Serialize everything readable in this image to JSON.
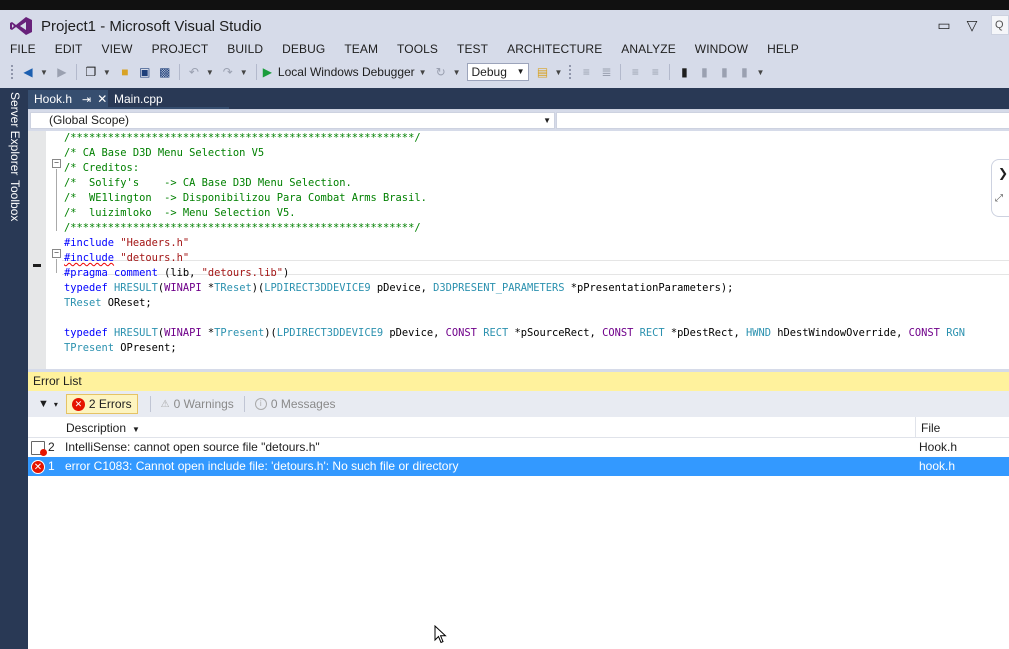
{
  "window": {
    "title": "Project1 - Microsoft Visual Studio"
  },
  "menu": [
    "FILE",
    "EDIT",
    "VIEW",
    "PROJECT",
    "BUILD",
    "DEBUG",
    "TEAM",
    "TOOLS",
    "TEST",
    "ARCHITECTURE",
    "ANALYZE",
    "WINDOW",
    "HELP"
  ],
  "toolbar": {
    "debugger_label": "Local Windows Debugger",
    "configuration": "Debug"
  },
  "quick_launch": {
    "placeholder": "Q"
  },
  "side_tabs": [
    "Server Explorer",
    "Toolbox"
  ],
  "doc_tabs": [
    {
      "label": "Hook.h",
      "active": true
    },
    {
      "label": "Main.cpp",
      "active": false
    }
  ],
  "navbar": {
    "scope": "(Global Scope)"
  },
  "code_lines": [
    [
      {
        "t": "/*******************************************************/",
        "c": "comment"
      }
    ],
    [
      {
        "t": "/* CA Base D3D Menu Selection V5",
        "c": "comment"
      }
    ],
    [
      {
        "t": "/* Creditos:",
        "c": "comment"
      }
    ],
    [
      {
        "t": "/*  Solify's    -> CA Base D3D Menu Selection.",
        "c": "comment"
      }
    ],
    [
      {
        "t": "/*  WE1lington  -> Disponibilizou Para Combat Arms Brasil.",
        "c": "comment"
      }
    ],
    [
      {
        "t": "/*  luizimloko  -> Menu Selection V5.",
        "c": "comment"
      }
    ],
    [
      {
        "t": "/*******************************************************/",
        "c": "comment"
      }
    ],
    [
      {
        "t": "#include ",
        "c": "kw"
      },
      {
        "t": "\"Headers.h\"",
        "c": "str"
      }
    ],
    [
      {
        "t": "#include",
        "c": "kw",
        "squiggle": true
      },
      {
        "t": " ",
        "c": "plain"
      },
      {
        "t": "\"detours.h\"",
        "c": "str"
      }
    ],
    [
      {
        "t": "#pragma ",
        "c": "kw"
      },
      {
        "t": "comment ",
        "c": "kw"
      },
      {
        "t": "(lib, ",
        "c": "plain"
      },
      {
        "t": "\"detours.lib\"",
        "c": "str"
      },
      {
        "t": ")",
        "c": "plain"
      }
    ],
    [
      {
        "t": "typedef ",
        "c": "kw"
      },
      {
        "t": "HRESULT",
        "c": "type"
      },
      {
        "t": "(",
        "c": "plain"
      },
      {
        "t": "WINAPI ",
        "c": "macro"
      },
      {
        "t": "*",
        "c": "plain"
      },
      {
        "t": "TReset",
        "c": "type"
      },
      {
        "t": ")(",
        "c": "plain"
      },
      {
        "t": "LPDIRECT3DDEVICE9",
        "c": "type"
      },
      {
        "t": " pDevice, ",
        "c": "plain"
      },
      {
        "t": "D3DPRESENT_PARAMETERS",
        "c": "type"
      },
      {
        "t": " *pPresentationParameters);",
        "c": "plain"
      }
    ],
    [
      {
        "t": "TReset",
        "c": "type"
      },
      {
        "t": " OReset;",
        "c": "plain"
      }
    ],
    [
      {
        "t": "",
        "c": "plain"
      }
    ],
    [
      {
        "t": "typedef ",
        "c": "kw"
      },
      {
        "t": "HRESULT",
        "c": "type"
      },
      {
        "t": "(",
        "c": "plain"
      },
      {
        "t": "WINAPI ",
        "c": "macro"
      },
      {
        "t": "*",
        "c": "plain"
      },
      {
        "t": "TPresent",
        "c": "type"
      },
      {
        "t": ")(",
        "c": "plain"
      },
      {
        "t": "LPDIRECT3DDEVICE9",
        "c": "type"
      },
      {
        "t": " pDevice, ",
        "c": "plain"
      },
      {
        "t": "CONST ",
        "c": "macro"
      },
      {
        "t": "RECT",
        "c": "type"
      },
      {
        "t": " *pSourceRect, ",
        "c": "plain"
      },
      {
        "t": "CONST ",
        "c": "macro"
      },
      {
        "t": "RECT",
        "c": "type"
      },
      {
        "t": " *pDestRect, ",
        "c": "plain"
      },
      {
        "t": "HWND",
        "c": "type"
      },
      {
        "t": " hDestWindowOverride, ",
        "c": "plain"
      },
      {
        "t": "CONST ",
        "c": "macro"
      },
      {
        "t": "RGN",
        "c": "type"
      }
    ],
    [
      {
        "t": "TPresent",
        "c": "type"
      },
      {
        "t": " OPresent;",
        "c": "plain"
      }
    ]
  ],
  "error_list": {
    "title": "Error List",
    "errors_label": "2 Errors",
    "warnings_label": "0 Warnings",
    "messages_label": "0 Messages",
    "columns": {
      "description": "Description",
      "file": "File"
    },
    "rows": [
      {
        "num": "2",
        "description": "IntelliSense: cannot open source file \"detours.h\"",
        "file": "Hook.h",
        "icon": "intellisense-error-icon",
        "selected": false
      },
      {
        "num": "1",
        "description": "error C1083: Cannot open include file: 'detours.h': No such file or directory",
        "file": "hook.h",
        "icon": "error-icon",
        "selected": true
      }
    ]
  },
  "colors": {
    "chrome": "#d6dbe9",
    "tab_strip": "#293955",
    "selection": "#3399ff",
    "error": "#e51400",
    "error_list_title": "#fff29d"
  }
}
